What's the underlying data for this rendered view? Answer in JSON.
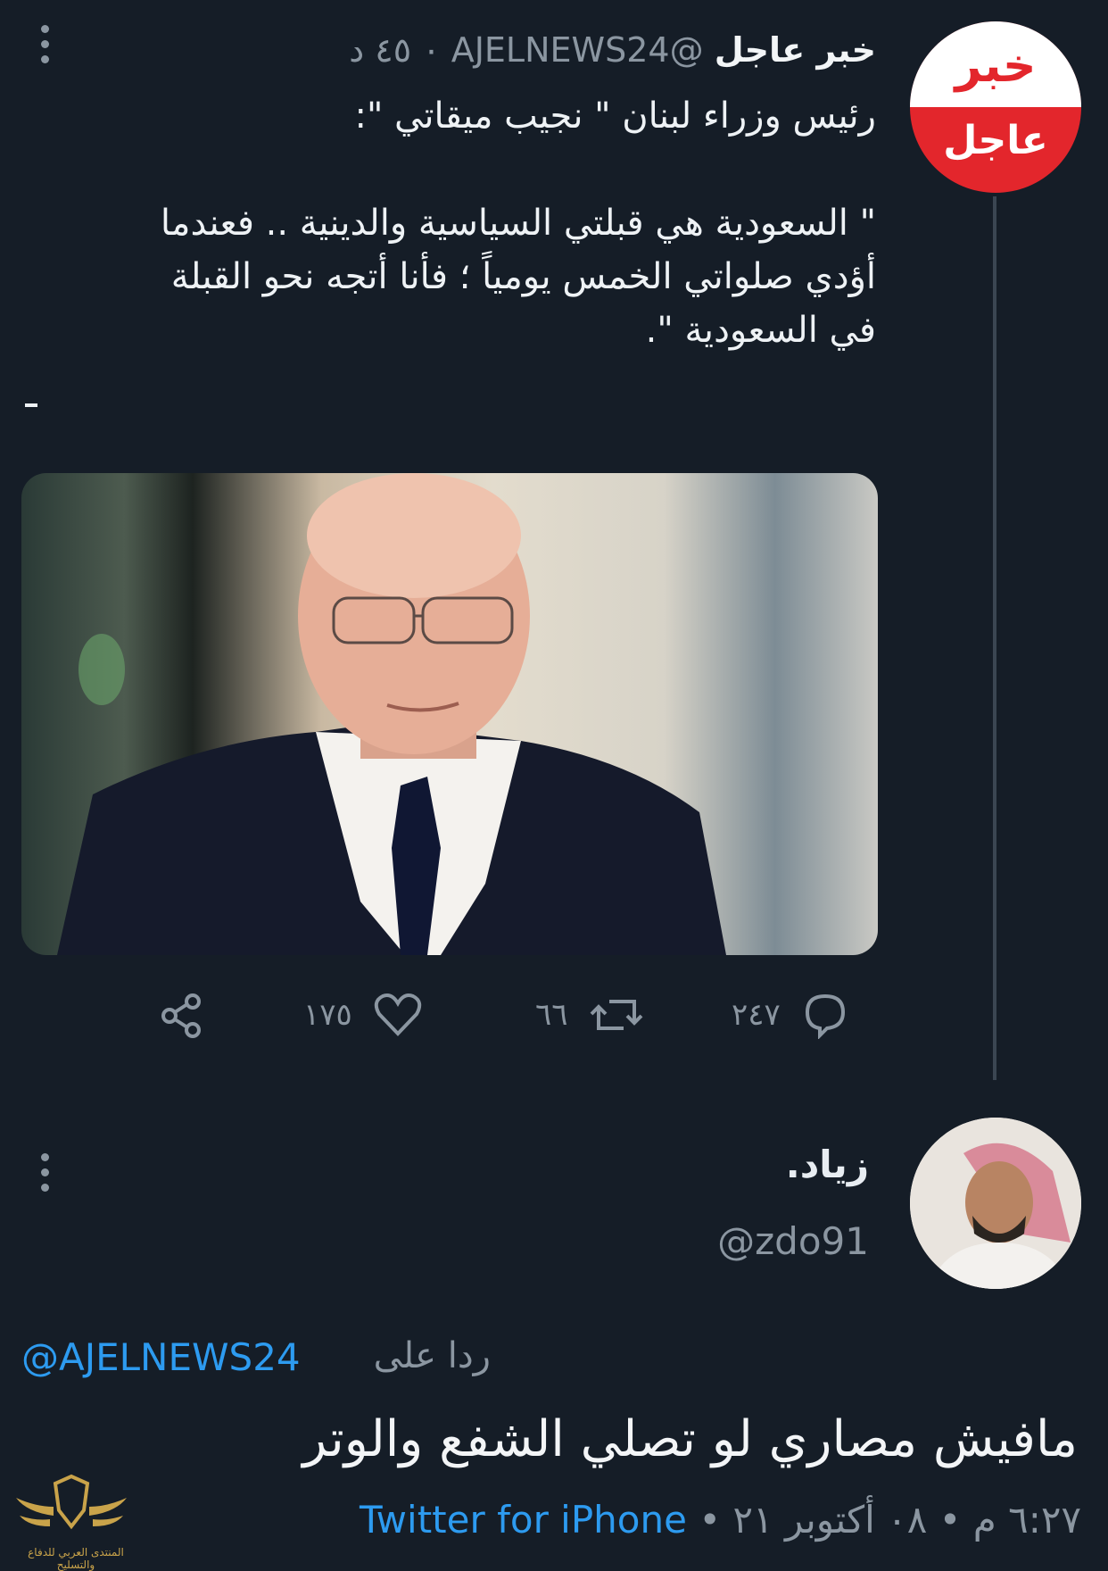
{
  "tweet": {
    "avatar_top_text": "خبر",
    "avatar_bottom_text": "عاجل",
    "display_name": "خبر عاجل",
    "handle": "@AJELNEWS24",
    "time_ago": "٠ ٤٥ د",
    "body_lines": [
      "رئيس وزراء لبنان \" نجيب ميقاتي \":",
      "",
      "\" السعودية هي قبلتي السياسية والدينية .. فعندما",
      "أؤدي صلواتي الخمس يومياً ؛ فأنا أتجه نحو القبلة",
      "في السعودية \"."
    ],
    "actions": {
      "replies": "٢٤٧",
      "retweets": "٦٦",
      "likes": "١٧٥"
    }
  },
  "reply": {
    "display_name": "زياد.",
    "handle": "@zdo91",
    "replying_prefix": "ردا على",
    "replying_to": "@AJELNEWS24",
    "text": "مافيش مصاري لو تصلي الشفع والوتر",
    "time": "٦:٢٧ م • ٠٨ أكتوبر ٢١",
    "separator": "•",
    "source": "Twitter for iPhone"
  },
  "watermark": {
    "text": "المنتدى العربي للدفاع والتسليح"
  },
  "colors": {
    "background": "#151d27",
    "link": "#2d9bf0",
    "muted": "#8b96a1",
    "brand_red": "#e3262c"
  }
}
